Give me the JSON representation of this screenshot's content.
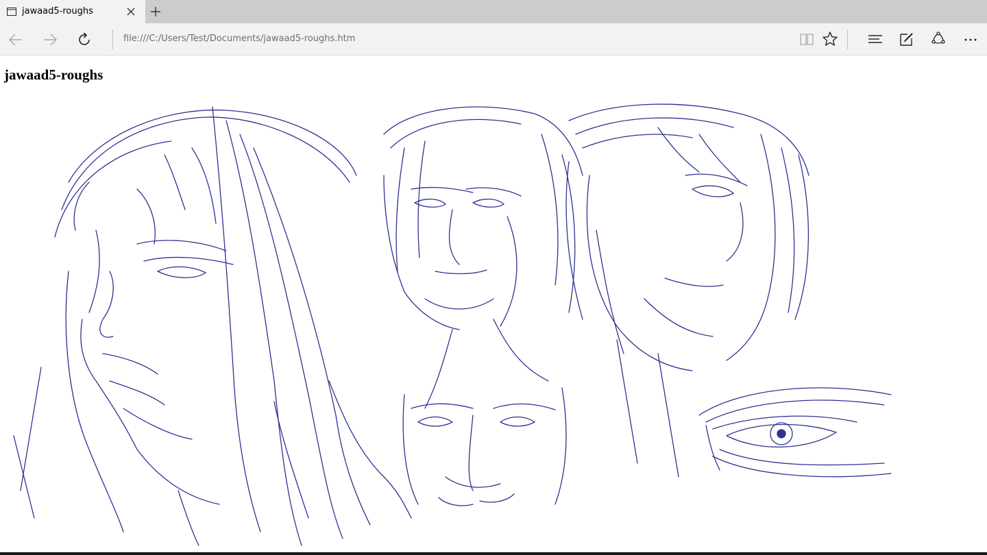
{
  "tab": {
    "title": "jawaad5-roughs",
    "icon": "page-icon",
    "close_icon": "close-icon",
    "new_tab_icon": "plus-icon"
  },
  "nav": {
    "back_icon": "arrow-left-icon",
    "forward_icon": "arrow-right-icon",
    "refresh_icon": "refresh-icon",
    "address": "file:///C:/Users/Test/Documents/jawaad5-roughs.htm"
  },
  "toolbar": {
    "reading_view_icon": "book-icon",
    "favorite_icon": "star-icon",
    "hub_icon": "hub-lines-icon",
    "web_note_icon": "pen-note-icon",
    "share_icon": "share-icon",
    "more_icon": "more-dots-icon"
  },
  "page": {
    "heading": "jawaad5-roughs"
  },
  "colors": {
    "sketch_ink": "#2e3192",
    "tabstrip": "#cccccc",
    "toolbar": "#f2f2f2",
    "address_text": "#6e6e6e"
  }
}
